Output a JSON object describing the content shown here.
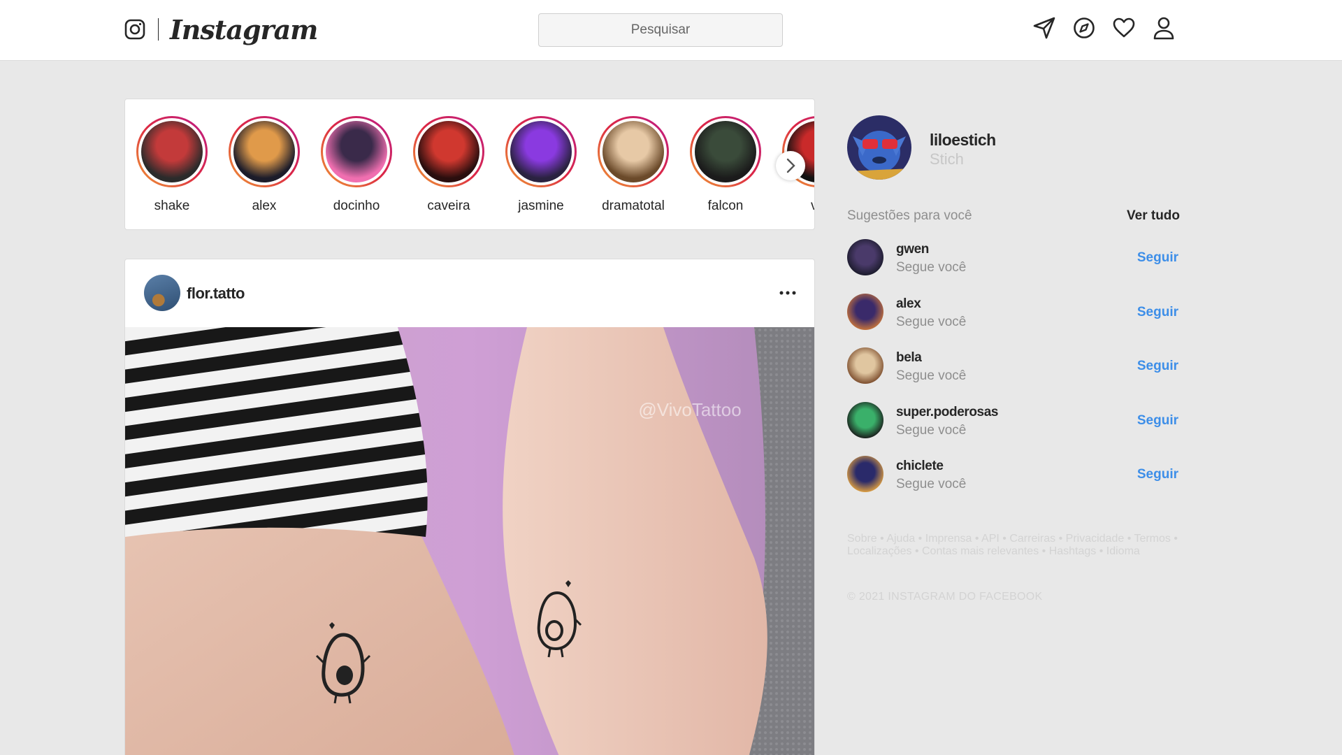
{
  "header": {
    "logo_text": "Instagram",
    "search_placeholder": "Pesquisar",
    "icons": [
      "camera-outline-icon",
      "paper-plane-icon",
      "compass-icon",
      "heart-icon",
      "user-icon"
    ]
  },
  "stories": [
    {
      "name": "shake",
      "colors": [
        "#c33a3a",
        "#2b2b2b"
      ]
    },
    {
      "name": "alex",
      "colors": [
        "#e09a4a",
        "#1c1c2a"
      ]
    },
    {
      "name": "docinho",
      "colors": [
        "#3a2a4a",
        "#f06fb0"
      ]
    },
    {
      "name": "caveira",
      "colors": [
        "#d0382f",
        "#2a0e0e"
      ]
    },
    {
      "name": "jasmine",
      "colors": [
        "#8a3ae0",
        "#2a2240"
      ]
    },
    {
      "name": "dramatotal",
      "colors": [
        "#e7c9a6",
        "#6b4a2a"
      ]
    },
    {
      "name": "falcon",
      "colors": [
        "#3a4b3a",
        "#1b1b1b"
      ]
    },
    {
      "name": "va",
      "colors": [
        "#c92a2a",
        "#121212"
      ]
    }
  ],
  "post": {
    "username": "flor.tatto",
    "more_label": "•••",
    "watermark": "@VivoTattoo"
  },
  "me": {
    "username": "liloestich",
    "name": "Stich"
  },
  "suggestions": {
    "title": "Sugestões para você",
    "see_all": "Ver tudo",
    "items": [
      {
        "username": "gwen",
        "sub": "Segue você",
        "action": "Seguir",
        "colors": [
          "#4a3a6a",
          "#1a1a2a"
        ]
      },
      {
        "username": "alex",
        "sub": "Segue você",
        "action": "Seguir",
        "colors": [
          "#3a2a6a",
          "#c9753a"
        ]
      },
      {
        "username": "bela",
        "sub": "Segue você",
        "action": "Seguir",
        "colors": [
          "#e0c6a0",
          "#7a4a2a"
        ]
      },
      {
        "username": "super.poderosas",
        "sub": "Segue você",
        "action": "Seguir",
        "colors": [
          "#3ab06a",
          "#1a1a1a"
        ]
      },
      {
        "username": "chiclete",
        "sub": "Segue você",
        "action": "Seguir",
        "colors": [
          "#2a2a6a",
          "#e0a040"
        ]
      }
    ]
  },
  "footer": {
    "links": [
      "Sobre",
      "Ajuda",
      "Imprensa",
      "API",
      "Carreiras",
      "Privacidade",
      "Termos",
      "Localizações",
      "Contas mais relevantes",
      "Hashtags",
      "Idioma"
    ],
    "copyright": "© 2021 INSTAGRAM DO FACEBOOK"
  },
  "colors": {
    "link_blue": "#3d8ee8",
    "story_ring": "#dc2743",
    "page_bg": "#e8e8e8"
  }
}
